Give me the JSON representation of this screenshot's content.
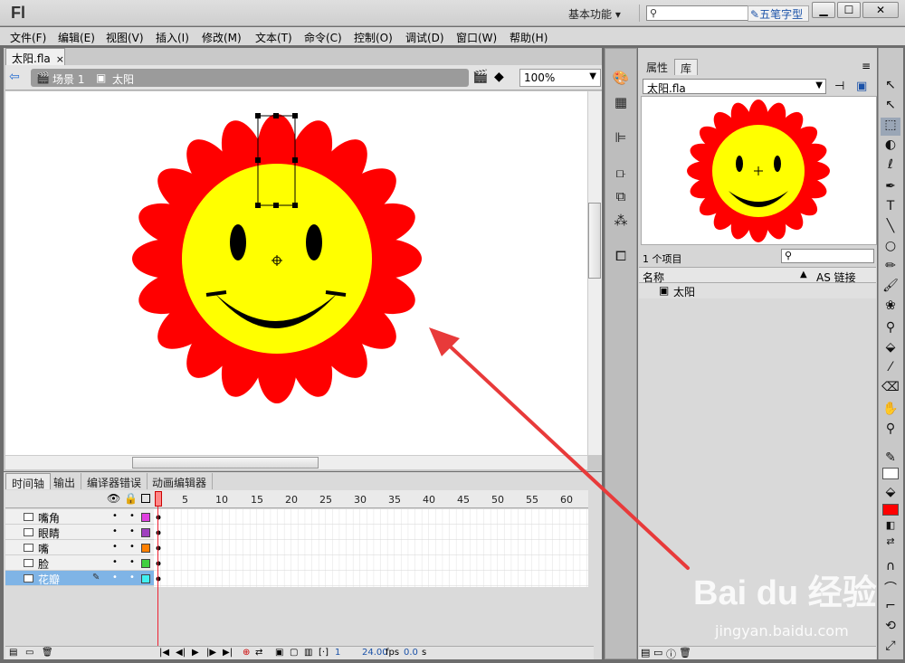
{
  "title": {
    "app_logo": "Fl",
    "workspace": "基本功能",
    "ime_label": "五笔字型"
  },
  "window_buttons": {
    "min": "▁",
    "max": "☐",
    "close": "✕"
  },
  "menu": [
    "文件(F)",
    "编辑(E)",
    "视图(V)",
    "插入(I)",
    "修改(M)",
    "文本(T)",
    "命令(C)",
    "控制(O)",
    "调试(D)",
    "窗口(W)",
    "帮助(H)"
  ],
  "document": {
    "tab": "太阳.fla",
    "close": "×",
    "scene": "场景 1",
    "symbol": "太阳",
    "zoom": "100%"
  },
  "timeline": {
    "tabs": [
      "时间轴",
      "输出",
      "编译器错误",
      "动画编辑器"
    ],
    "frame_numbers": [
      "1",
      "5",
      "10",
      "15",
      "20",
      "25",
      "30",
      "35",
      "40",
      "45",
      "50",
      "55",
      "60"
    ],
    "layers": [
      {
        "name": "嘴角",
        "color": "#e040e0"
      },
      {
        "name": "眼睛",
        "color": "#a040c0"
      },
      {
        "name": "嘴",
        "color": "#ff8000"
      },
      {
        "name": "脸",
        "color": "#40d040"
      },
      {
        "name": "花瓣",
        "color": "#40f0f0"
      }
    ],
    "status": {
      "frame": "1",
      "fps": "24.00",
      "fps_unit": "fps",
      "time": "0.0",
      "time_unit": "s"
    }
  },
  "library": {
    "tabs": [
      "属性",
      "库"
    ],
    "file": "太阳.fla",
    "count": "1 个项目",
    "col_name": "名称",
    "col_link": "AS 链接",
    "items": [
      "太阳"
    ]
  },
  "watermark": {
    "brand": "Bai du 经验",
    "url": "jingyan.baidu.com"
  },
  "colors": {
    "petal": "#ff0000",
    "face": "#ffff00",
    "fill_swatch": "#ff0000",
    "arrow": "#e83a3a"
  }
}
